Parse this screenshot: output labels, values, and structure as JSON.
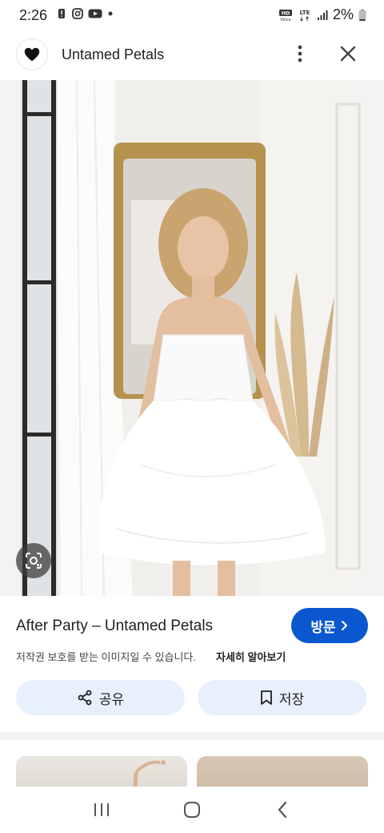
{
  "status_bar": {
    "time": "2:26",
    "battery": "2%",
    "icons": [
      "alert-icon",
      "instagram-icon",
      "youtube-icon",
      "dot-icon",
      "hd-voice-icon",
      "lte-icon",
      "signal-icon",
      "battery-icon"
    ]
  },
  "header": {
    "site_name": "Untamed Petals",
    "avatar_icon": "heart-icon",
    "menu_icon": "more-vert-icon",
    "close_icon": "close-icon"
  },
  "image": {
    "lens_icon": "lens-icon"
  },
  "info": {
    "title": "After Party – Untamed Petals",
    "visit_label": "방문",
    "copyright": "저작권 보호를 받는 이미지일 수 있습니다.",
    "learn_more": "자세히 알아보기",
    "share_label": "공유",
    "save_label": "저장"
  },
  "colors": {
    "accent": "#0b57d0",
    "pill_bg": "#e8f0fe"
  }
}
